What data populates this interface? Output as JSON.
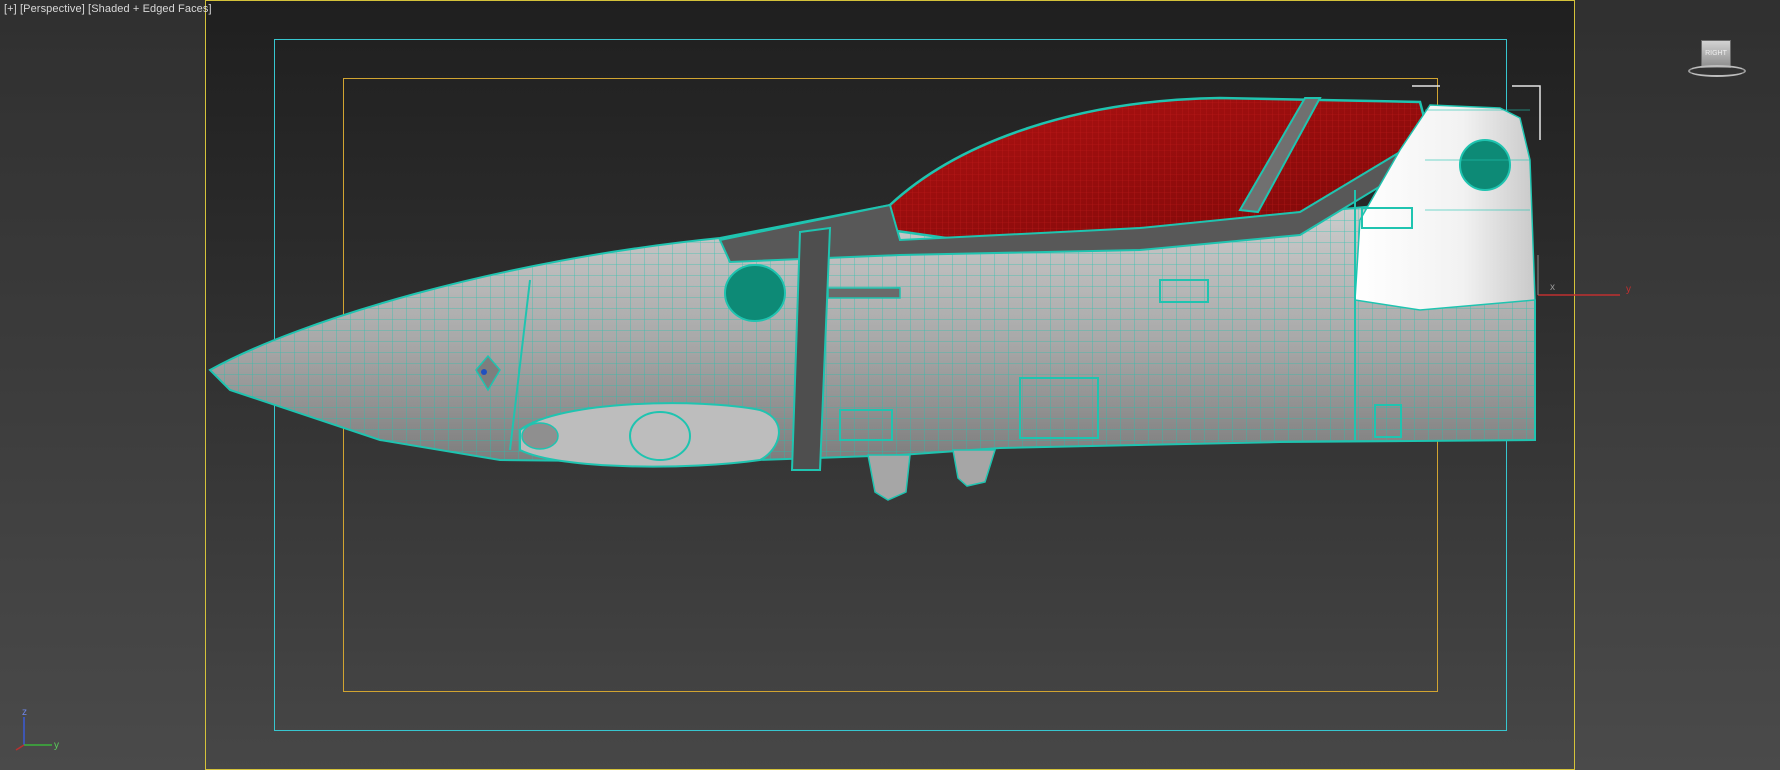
{
  "viewport": {
    "label_parts": [
      "[+]",
      "[Perspective]",
      "[Shaded + Edged Faces]"
    ]
  },
  "viewcube": {
    "face": "RIGHT"
  },
  "gizmo": {
    "x_label": "x",
    "y_label": "y"
  },
  "axis_tripod": {
    "z_label": "z",
    "y_label": "y"
  },
  "colors": {
    "background_top": "#1f1f1f",
    "background_bottom": "#474747",
    "camera_frame": "#d4c23a",
    "action_safe": "#37c6cf",
    "title_safe": "#d1a431",
    "wireframe": "#1fc4b0",
    "hull": "#a9a9a9",
    "canopy": "#a01010",
    "hole_fill": "#0d8a76"
  }
}
